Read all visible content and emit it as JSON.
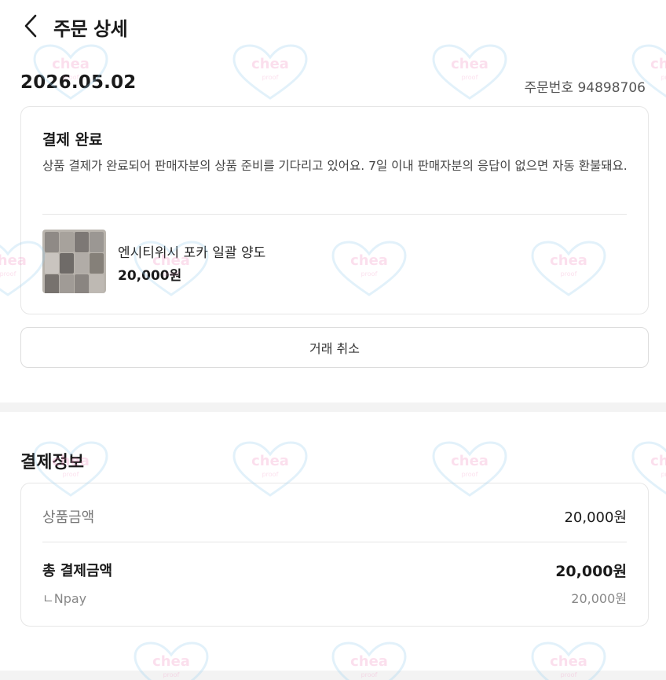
{
  "header": {
    "title": "주문 상세",
    "back_icon": "chevron-left-icon"
  },
  "order": {
    "date": "2026.05.02",
    "number_text": "주문번호 94898706"
  },
  "status": {
    "title": "결제 완료",
    "description": "상품 결제가 완료되어 판매자분의 상품 준비를 기다리고 있어요. 7일 이내 판매자분의 응답이 없으면 자동 환불돼요."
  },
  "product": {
    "name": "엔시티위시 포카 일괄 양도",
    "price": "20,000원"
  },
  "cancel_button": "거래 취소",
  "payment": {
    "section_title": "결제정보",
    "item_amount_label": "상품금액",
    "item_amount_value": "20,000원",
    "total_label": "총 결제금액",
    "total_value": "20,000원",
    "method_label": "ㄴNpay",
    "method_value": "20,000원"
  },
  "watermark": {
    "text_main": "chea",
    "text_sub": "proof",
    "color": "#f48fc0"
  }
}
